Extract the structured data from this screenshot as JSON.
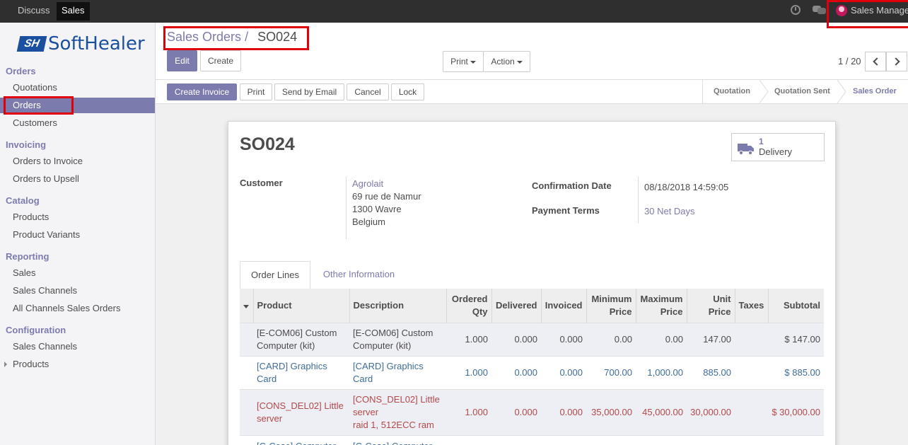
{
  "topbar": {
    "menus": [
      "Discuss",
      "Sales"
    ],
    "user_name": "Sales Manager"
  },
  "sidebar": {
    "logo_mark": "SH",
    "logo_text": "SoftHealer",
    "sections": [
      {
        "title": "Orders",
        "items": [
          "Quotations",
          "Orders",
          "Customers"
        ]
      },
      {
        "title": "Invoicing",
        "items": [
          "Orders to Invoice",
          "Orders to Upsell"
        ]
      },
      {
        "title": "Catalog",
        "items": [
          "Products",
          "Product Variants"
        ]
      },
      {
        "title": "Reporting",
        "items": [
          "Sales",
          "Sales Channels",
          "All Channels Sales Orders"
        ]
      },
      {
        "title": "Configuration",
        "items": [
          "Sales Channels",
          "Products"
        ]
      }
    ],
    "active_item": "Orders"
  },
  "breadcrumb": {
    "parent": "Sales Orders",
    "separator": "/",
    "current": "SO024"
  },
  "toolbar": {
    "edit": "Edit",
    "create": "Create",
    "print": "Print",
    "action": "Action",
    "pager": "1 / 20"
  },
  "statusbar": {
    "buttons": [
      "Create Invoice",
      "Print",
      "Send by Email",
      "Cancel",
      "Lock"
    ],
    "stages": [
      "Quotation",
      "Quotation Sent",
      "Sales Order"
    ],
    "current_stage": "Sales Order"
  },
  "form": {
    "name": "SO024",
    "delivery_count": "1",
    "delivery_label": "Delivery",
    "customer_label": "Customer",
    "customer_name": "Agrolait",
    "address": [
      "69 rue de Namur",
      "1300 Wavre",
      "Belgium"
    ],
    "confirmation_date_label": "Confirmation Date",
    "confirmation_date": "08/18/2018 14:59:05",
    "payment_terms_label": "Payment Terms",
    "payment_terms": "30 Net Days"
  },
  "tabs": [
    "Order Lines",
    "Other Information"
  ],
  "order_lines": {
    "headers": [
      "Product",
      "Description",
      "Ordered Qty",
      "Delivered",
      "Invoiced",
      "Minimum Price",
      "Maximum Price",
      "Unit Price",
      "Taxes",
      "Subtotal"
    ],
    "rows": [
      {
        "product": "[E-COM06] Custom Computer (kit)",
        "description": "[E-COM06] Custom Computer (kit)",
        "qty": "1.000",
        "delivered": "0.000",
        "invoiced": "0.000",
        "min": "0.00",
        "max": "0.00",
        "unit": "147.00",
        "taxes": "",
        "subtotal": "$ 147.00"
      },
      {
        "product": "[CARD] Graphics Card",
        "description": "[CARD] Graphics Card",
        "qty": "1.000",
        "delivered": "0.000",
        "invoiced": "0.000",
        "min": "700.00",
        "max": "1,000.00",
        "unit": "885.00",
        "taxes": "",
        "subtotal": "$ 885.00"
      },
      {
        "product": "[CONS_DEL02] Little server",
        "description": "[CONS_DEL02] Little server\nraid 1, 512ECC ram",
        "qty": "1.000",
        "delivered": "0.000",
        "invoiced": "0.000",
        "min": "35,000.00",
        "max": "45,000.00",
        "unit": "30,000.00",
        "taxes": "",
        "subtotal": "$ 30,000.00"
      },
      {
        "product": "[C-Case] Computer",
        "description": "[C-Case] Computer",
        "qty": "",
        "delivered": "",
        "invoiced": "",
        "min": "",
        "max": "",
        "unit": "",
        "taxes": "",
        "subtotal": ""
      }
    ]
  },
  "colors": {
    "accent": "#7c7bad",
    "highlight": "#e0000b",
    "topbar": "#2f2f2f"
  }
}
